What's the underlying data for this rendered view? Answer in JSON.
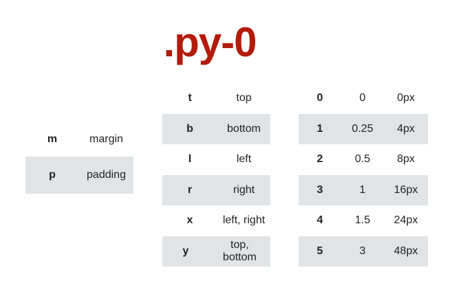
{
  "title": ".py-0",
  "colors": {
    "title": "#b31b0a",
    "stripe": "#e1e3e6"
  },
  "property_table": [
    {
      "abbr": "m",
      "name": "margin"
    },
    {
      "abbr": "p",
      "name": "padding"
    }
  ],
  "sides_table": [
    {
      "abbr": "t",
      "name": "top"
    },
    {
      "abbr": "b",
      "name": "bottom"
    },
    {
      "abbr": "l",
      "name": "left"
    },
    {
      "abbr": "r",
      "name": "right"
    },
    {
      "abbr": "x",
      "name": "left, right"
    },
    {
      "abbr": "y",
      "name": "top, bottom"
    }
  ],
  "size_table": [
    {
      "key": "0",
      "rem": "0",
      "px": "0px"
    },
    {
      "key": "1",
      "rem": "0.25",
      "px": "4px"
    },
    {
      "key": "2",
      "rem": "0.5",
      "px": "8px"
    },
    {
      "key": "3",
      "rem": "1",
      "px": "16px"
    },
    {
      "key": "4",
      "rem": "1.5",
      "px": "24px"
    },
    {
      "key": "5",
      "rem": "3",
      "px": "48px"
    }
  ]
}
